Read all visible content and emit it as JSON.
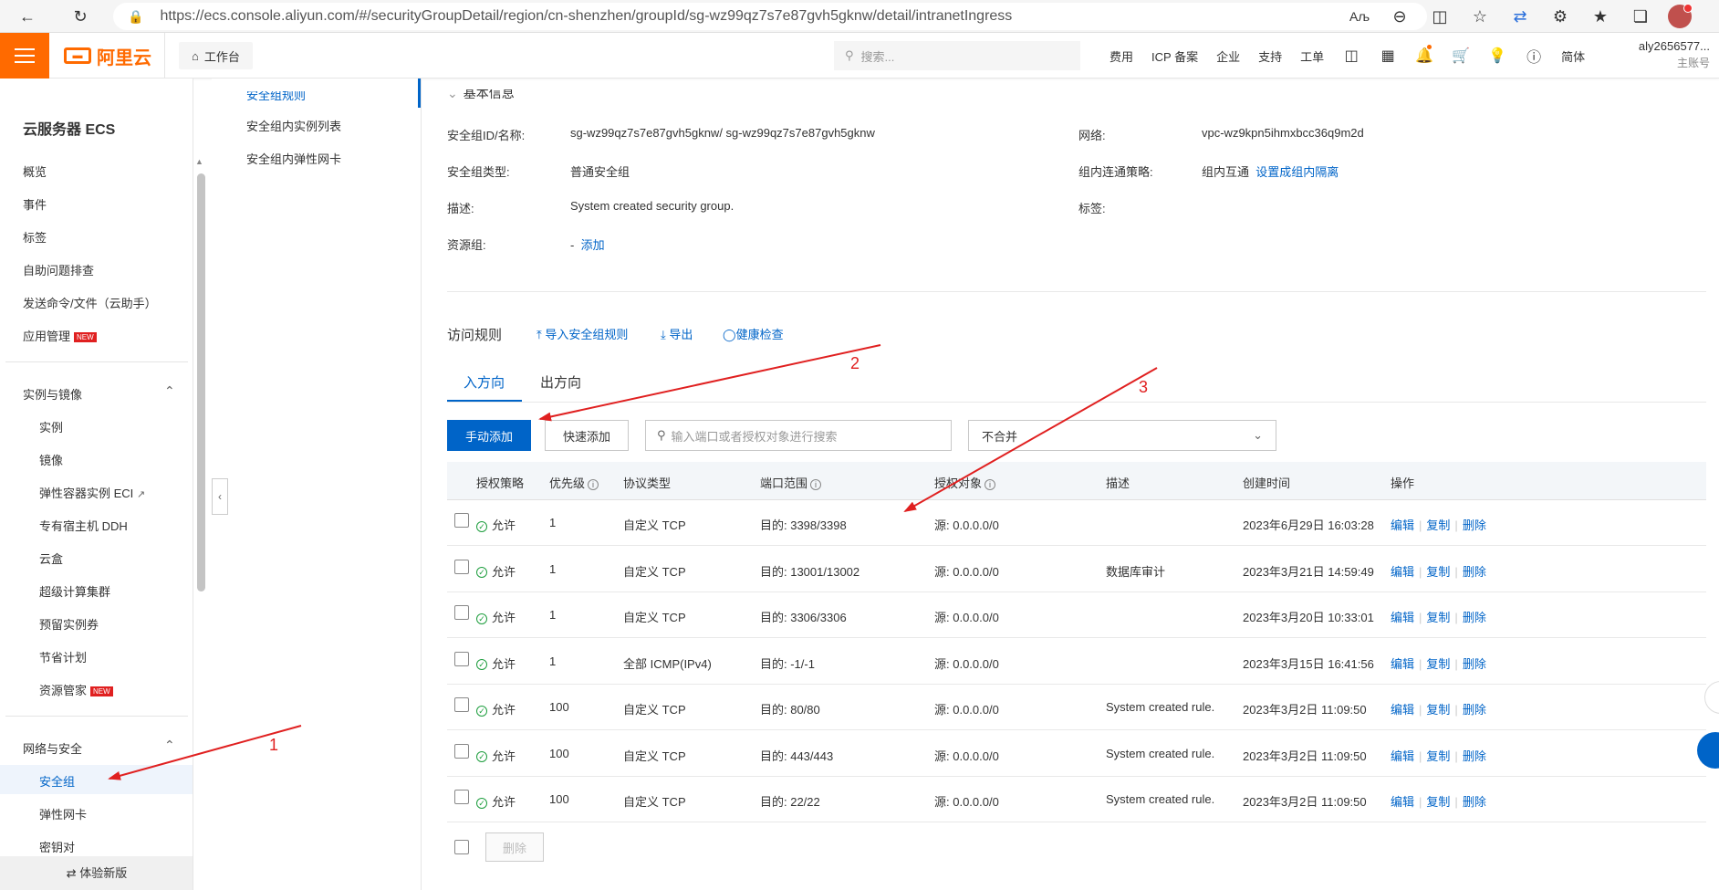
{
  "browser": {
    "url": "https://ecs.console.aliyun.com/#/securityGroupDetail/region/cn-shenzhen/groupId/sg-wz99qz7s7e87gvh5gknw/detail/intranetIngress"
  },
  "topnav": {
    "brand": "阿里云",
    "workbench": "工作台",
    "search_placeholder": "搜索...",
    "links": [
      "费用",
      "ICP 备案",
      "企业",
      "支持",
      "工单"
    ],
    "lang": "简体",
    "account_name": "aly2656577...",
    "account_role": "主账号"
  },
  "sidebar": {
    "title": "云服务器 ECS",
    "top_items": [
      "概览",
      "事件",
      "标签",
      "自助问题排查",
      "发送命令/文件（云助手）",
      "应用管理"
    ],
    "new_badge": "NEW",
    "group1": {
      "title": "实例与镜像",
      "items": [
        "实例",
        "镜像",
        "弹性容器实例 ECI",
        "专有宿主机 DDH",
        "云盒",
        "超级计算集群",
        "预留实例券",
        "节省计划",
        "资源管家"
      ]
    },
    "group2": {
      "title": "网络与安全",
      "items": [
        "安全组",
        "弹性网卡",
        "密钥对"
      ]
    },
    "bottom": "体验新版"
  },
  "subnav": {
    "items": [
      "安全组规则",
      "安全组内实例列表",
      "安全组内弹性网卡"
    ]
  },
  "basic_info": {
    "heading": "基本信息",
    "labels": {
      "id": "安全组ID/名称:",
      "type": "安全组类型:",
      "desc": "描述:",
      "rg": "资源组:",
      "network": "网络:",
      "policy": "组内连通策略:",
      "tags": "标签:"
    },
    "values": {
      "id": "sg-wz99qz7s7e87gvh5gknw/ sg-wz99qz7s7e87gvh5gknw",
      "type": "普通安全组",
      "desc": "System created security group.",
      "rg_dash": "-",
      "rg_add": "添加",
      "network": "vpc-wz9kpn5ihmxbcc36q9m2d",
      "policy": "组内互通",
      "policy_link": "设置成组内隔离"
    }
  },
  "rules": {
    "title": "访问规则",
    "import": "导入安全组规则",
    "export": "导出",
    "health": "健康检查",
    "tabs": [
      "入方向",
      "出方向"
    ],
    "btn_manual": "手动添加",
    "btn_quick": "快速添加",
    "search_placeholder": "输入端口或者授权对象进行搜索",
    "merge_select": "不合并",
    "headers": [
      "授权策略",
      "优先级",
      "协议类型",
      "端口范围",
      "授权对象",
      "描述",
      "创建时间",
      "操作"
    ],
    "ops": [
      "编辑",
      "复制",
      "删除"
    ],
    "rows": [
      {
        "policy": "允许",
        "priority": "1",
        "protocol": "自定义 TCP",
        "port": "目的: 3398/3398",
        "source": "源: 0.0.0.0/0",
        "desc": "",
        "created": "2023年6月29日 16:03:28"
      },
      {
        "policy": "允许",
        "priority": "1",
        "protocol": "自定义 TCP",
        "port": "目的: 13001/13002",
        "source": "源: 0.0.0.0/0",
        "desc": "数据库审计",
        "created": "2023年3月21日 14:59:49"
      },
      {
        "policy": "允许",
        "priority": "1",
        "protocol": "自定义 TCP",
        "port": "目的: 3306/3306",
        "source": "源: 0.0.0.0/0",
        "desc": "",
        "created": "2023年3月20日 10:33:01"
      },
      {
        "policy": "允许",
        "priority": "1",
        "protocol": "全部 ICMP(IPv4)",
        "port": "目的: -1/-1",
        "source": "源: 0.0.0.0/0",
        "desc": "",
        "created": "2023年3月15日 16:41:56"
      },
      {
        "policy": "允许",
        "priority": "100",
        "protocol": "自定义 TCP",
        "port": "目的: 80/80",
        "source": "源: 0.0.0.0/0",
        "desc": "System created rule.",
        "created": "2023年3月2日 11:09:50"
      },
      {
        "policy": "允许",
        "priority": "100",
        "protocol": "自定义 TCP",
        "port": "目的: 443/443",
        "source": "源: 0.0.0.0/0",
        "desc": "System created rule.",
        "created": "2023年3月2日 11:09:50"
      },
      {
        "policy": "允许",
        "priority": "100",
        "protocol": "自定义 TCP",
        "port": "目的: 22/22",
        "source": "源: 0.0.0.0/0",
        "desc": "System created rule.",
        "created": "2023年3月2日 11:09:50"
      }
    ],
    "footer_delete": "删除"
  },
  "annotations": {
    "labels": [
      "1",
      "2",
      "3"
    ],
    "color": "#e02020"
  }
}
